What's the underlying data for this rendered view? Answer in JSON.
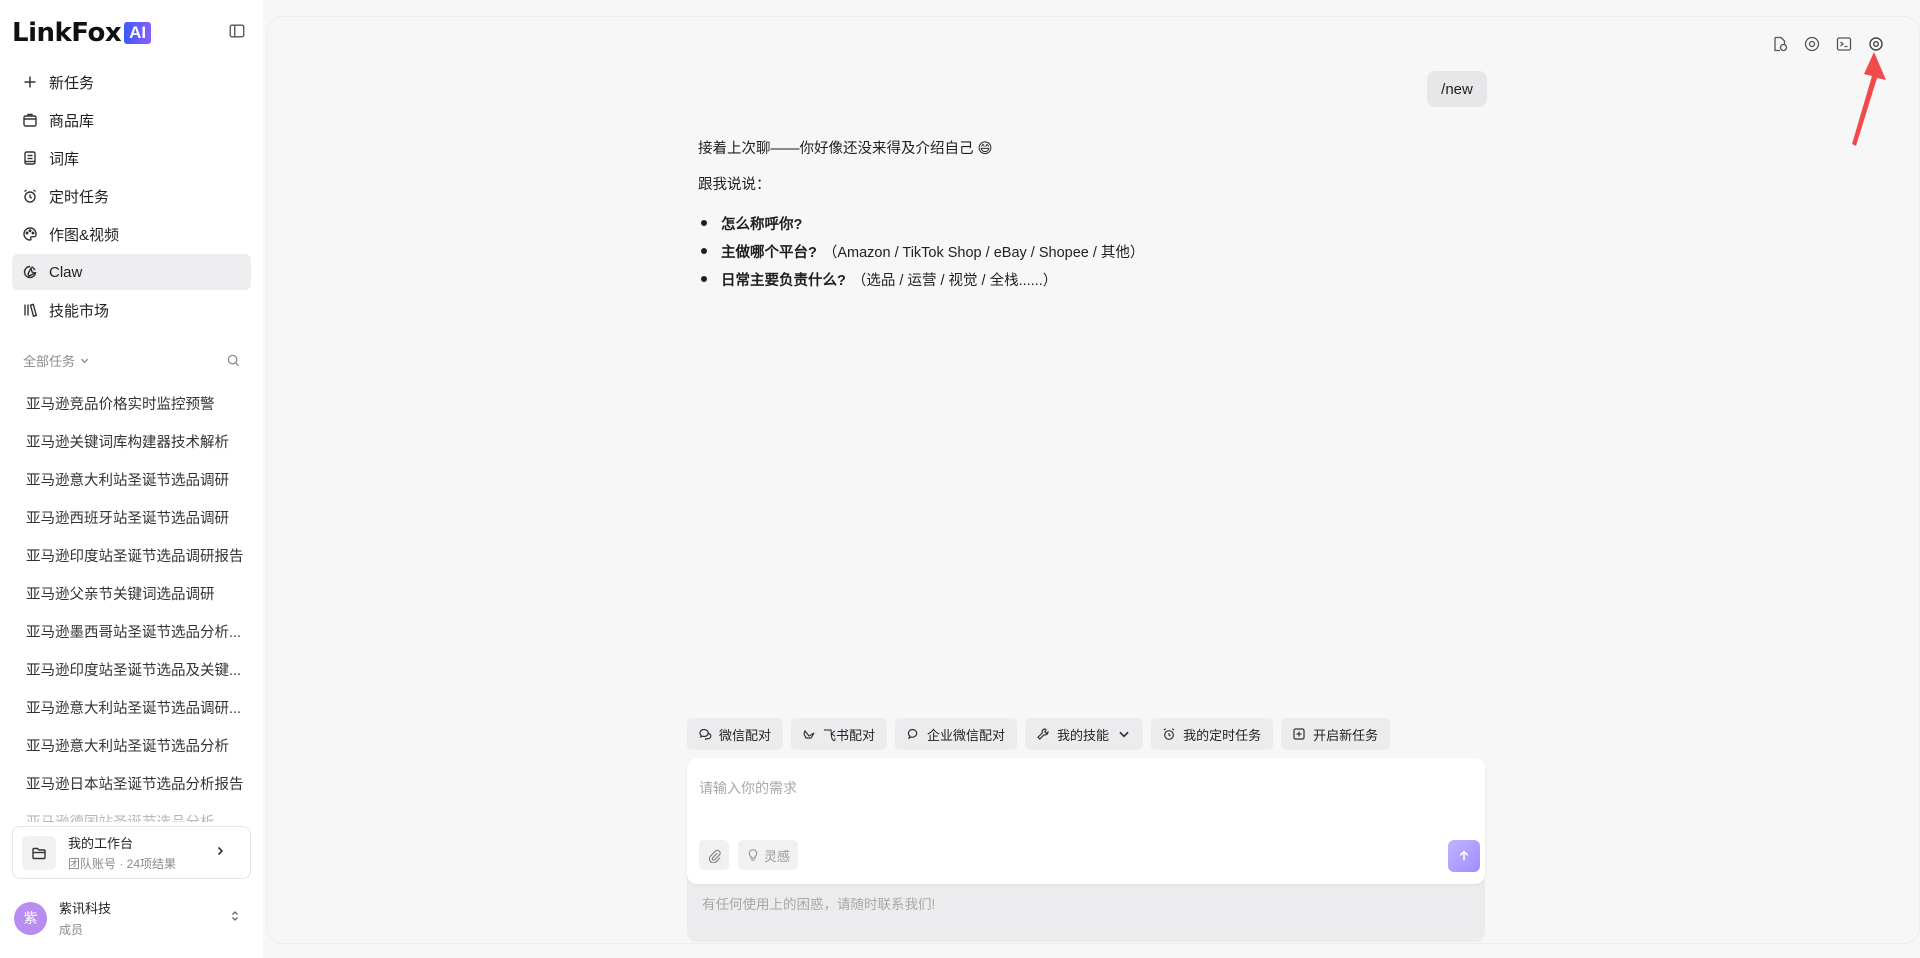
{
  "brand": {
    "name": "LinkFox",
    "badge": "AI"
  },
  "sidebar": {
    "nav": [
      {
        "label": "新任务",
        "icon": "plus-icon"
      },
      {
        "label": "商品库",
        "icon": "box-icon"
      },
      {
        "label": "词库",
        "icon": "book-icon"
      },
      {
        "label": "定时任务",
        "icon": "alarm-icon"
      },
      {
        "label": "作图&视频",
        "icon": "palette-icon"
      },
      {
        "label": "Claw",
        "icon": "claw-icon",
        "active": true
      },
      {
        "label": "技能市场",
        "icon": "library-icon"
      }
    ],
    "filter_label": "全部任务",
    "tasks": [
      "亚马逊竞品价格实时监控预警",
      "亚马逊关键词库构建器技术解析",
      "亚马逊意大利站圣诞节选品调研",
      "亚马逊西班牙站圣诞节选品调研",
      "亚马逊印度站圣诞节选品调研报告",
      "亚马逊父亲节关键词选品调研",
      "亚马逊墨西哥站圣诞节选品分析...",
      "亚马逊印度站圣诞节选品及关键...",
      "亚马逊意大利站圣诞节选品调研...",
      "亚马逊意大利站圣诞节选品分析",
      "亚马逊日本站圣诞节选品分析报告",
      "亚马逊德国站圣诞节选品分析..."
    ],
    "workspace": {
      "title": "我的工作台",
      "subtitle": "团队账号 · 24项结果"
    },
    "user": {
      "avatar": "紫",
      "name": "紫讯科技",
      "role": "成员"
    }
  },
  "chat": {
    "user_message": "/new",
    "assistant": {
      "line1": "接着上次聊——你好像还没来得及介绍自己 😄",
      "line2": "跟我说说：",
      "items": [
        {
          "bold": "怎么称呼你?",
          "rest": ""
        },
        {
          "bold": "主做哪个平台?",
          "rest": "（Amazon / TikTok Shop / eBay / Shopee / 其他）"
        },
        {
          "bold": "日常主要负责什么?",
          "rest": "（选品 / 运营 / 视觉 / 全栈......）"
        }
      ]
    }
  },
  "quick_actions": {
    "wechat": "微信配对",
    "feishu": "飞书配对",
    "wecom": "企业微信配对",
    "skills": "我的技能",
    "schedule": "我的定时任务",
    "new_task": "开启新任务"
  },
  "composer": {
    "placeholder": "请输入你的需求",
    "idea_label": "灵感",
    "help": "有任何使用上的困惑，请随时联系我们!"
  },
  "colors": {
    "accent": "#9e90ff",
    "active_nav": "#eeeef0",
    "arrow": "#f04a4a"
  }
}
